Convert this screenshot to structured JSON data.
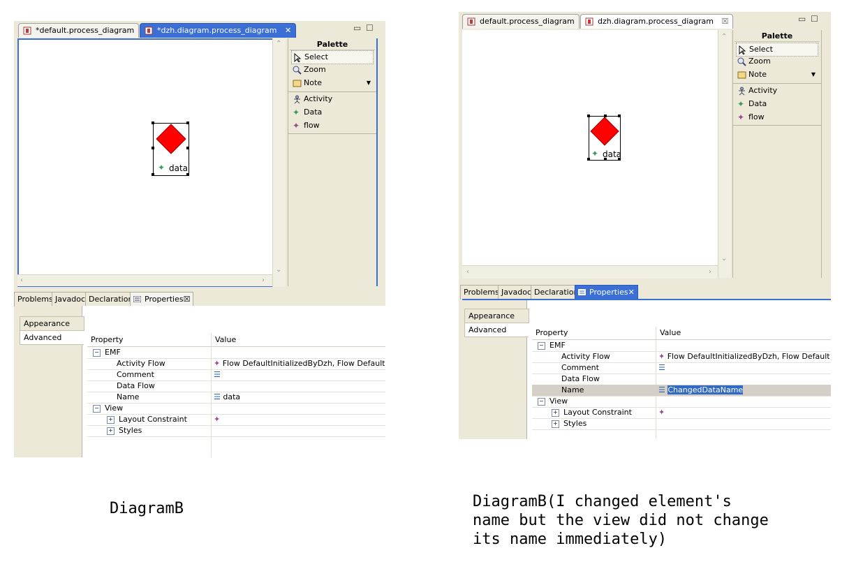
{
  "left": {
    "editor_tabs": [
      {
        "label": "*default.process_diagram",
        "active": false
      },
      {
        "label": "*dzh.diagram.process_diagram",
        "active": true,
        "close": "✕"
      }
    ],
    "palette": {
      "title": "Palette",
      "items": [
        "Select",
        "Zoom",
        "Note",
        "Activity",
        "Data",
        "flow"
      ]
    },
    "node_label": "data",
    "view_tabs": [
      "Problems",
      "Javadoc",
      "Declaration",
      "Properties"
    ],
    "side_tabs": [
      "Appearance",
      "Advanced"
    ],
    "header": {
      "property": "Property",
      "value": "Value"
    },
    "rows": [
      {
        "indent": 0,
        "expander": "−",
        "label": "EMF",
        "value": ""
      },
      {
        "indent": 2,
        "label": "Activity Flow",
        "value": "Flow DefaultInitializedByDzh, Flow DefaultInitiali",
        "icon": "flow"
      },
      {
        "indent": 2,
        "label": "Comment",
        "value": "",
        "icon": "list"
      },
      {
        "indent": 2,
        "label": "Data Flow",
        "value": ""
      },
      {
        "indent": 2,
        "label": "Name",
        "value": "data",
        "icon": "list"
      },
      {
        "indent": 0,
        "expander": "−",
        "label": "View",
        "value": ""
      },
      {
        "indent": 1,
        "expander": "+",
        "label": "Layout Constraint",
        "value": "",
        "icon": "flow"
      },
      {
        "indent": 1,
        "expander": "+",
        "label": "Styles",
        "value": ""
      }
    ]
  },
  "right": {
    "editor_tabs": [
      {
        "label": "default.process_diagram",
        "active": false
      },
      {
        "label": "dzh.diagram.process_diagram",
        "active": false,
        "close": "☒"
      }
    ],
    "palette": {
      "title": "Palette",
      "items": [
        "Select",
        "Zoom",
        "Note",
        "Activity",
        "Data",
        "flow"
      ]
    },
    "node_label": "data",
    "view_tabs": [
      "Problems",
      "Javadoc",
      "Declaration",
      "Properties"
    ],
    "side_tabs": [
      "Appearance",
      "Advanced"
    ],
    "header": {
      "property": "Property",
      "value": "Value"
    },
    "rows": [
      {
        "indent": 0,
        "expander": "−",
        "label": "EMF",
        "value": ""
      },
      {
        "indent": 2,
        "label": "Activity Flow",
        "value": "Flow DefaultInitializedByDzh, Flow DefaultInitiali:",
        "icon": "flow"
      },
      {
        "indent": 2,
        "label": "Comment",
        "value": "",
        "icon": "list"
      },
      {
        "indent": 2,
        "label": "Data Flow",
        "value": ""
      },
      {
        "indent": 2,
        "label": "Name",
        "value": "ChangedDataName",
        "icon": "list",
        "editing": true
      },
      {
        "indent": 0,
        "expander": "−",
        "label": "View",
        "value": ""
      },
      {
        "indent": 1,
        "expander": "+",
        "label": "Layout Constraint",
        "value": "",
        "icon": "flow"
      },
      {
        "indent": 1,
        "expander": "+",
        "label": "Styles",
        "value": ""
      }
    ]
  },
  "captions": {
    "left": "DiagramB",
    "right": "DiagramB(I changed element's\nname but the view did not change\nits name immediately)"
  },
  "colors": {
    "node": "#ff0000",
    "accent": "#3b6fd6",
    "data_icon": "#3a9a5a",
    "flow_icon": "#9a4a8a"
  }
}
